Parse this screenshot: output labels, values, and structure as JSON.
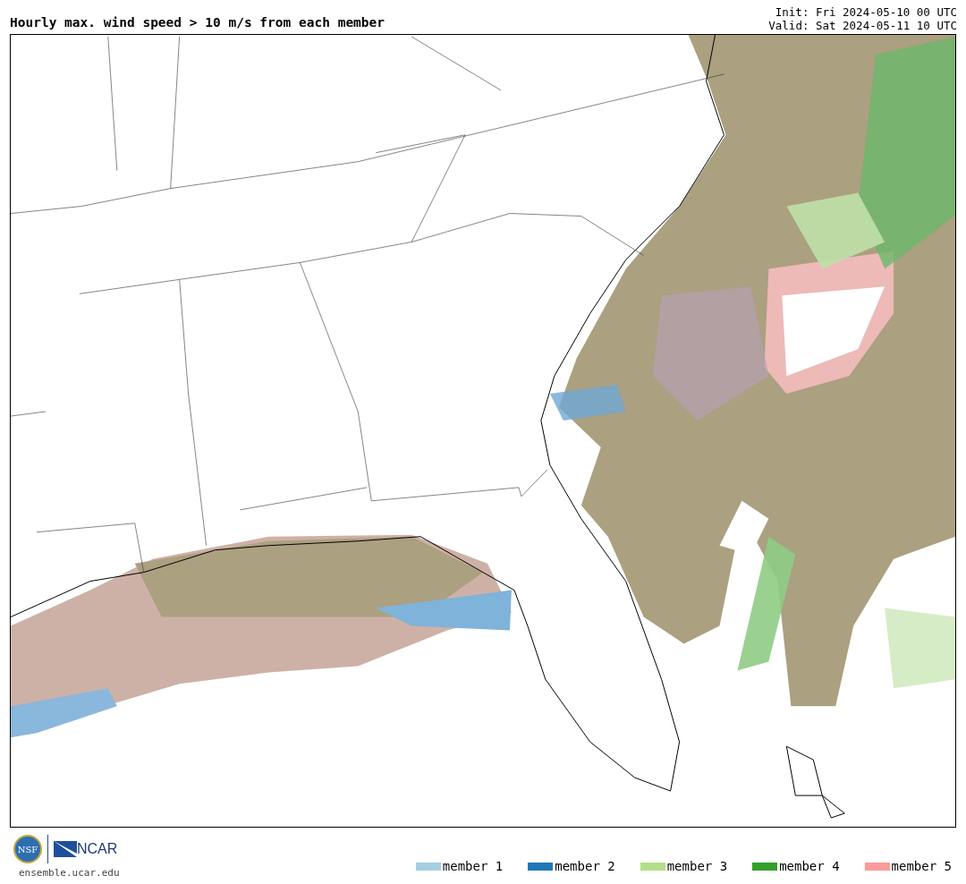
{
  "title": "Hourly max. wind speed > 10 m/s from each member",
  "init": "Init: Fri 2024-05-10 00 UTC",
  "valid": "Valid: Sat 2024-05-11 10 UTC",
  "logos": {
    "nsf": "NSF",
    "ncar": "NCAR"
  },
  "url": "ensemble.ucar.edu",
  "legend": [
    {
      "label": "member 1",
      "color": "#a6cee3"
    },
    {
      "label": "member 2",
      "color": "#1f78b4"
    },
    {
      "label": "member 3",
      "color": "#b2df8a"
    },
    {
      "label": "member 4",
      "color": "#33a02c"
    },
    {
      "label": "member 5",
      "color": "#fb9a99"
    }
  ]
}
